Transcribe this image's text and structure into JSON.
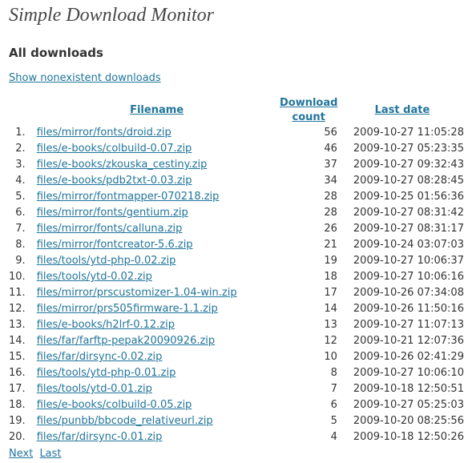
{
  "page": {
    "title": "Simple Download Monitor",
    "subtitle": "All downloads",
    "show_nonexistent_link": "Show nonexistent downloads"
  },
  "table": {
    "columns": {
      "filename": "Filename",
      "download_count_line1": "Download",
      "download_count_line2": "count",
      "last_date": "Last date"
    },
    "rows": [
      {
        "num": "1.",
        "file": "files/mirror/fonts/droid.zip",
        "count": "56",
        "date": "2009-10-27 11:05:28"
      },
      {
        "num": "2.",
        "file": "files/e-books/colbuild-0.07.zip",
        "count": "46",
        "date": "2009-10-27 05:23:35"
      },
      {
        "num": "3.",
        "file": "files/e-books/zkouska_cestiny.zip",
        "count": "37",
        "date": "2009-10-27 09:32:43"
      },
      {
        "num": "4.",
        "file": "files/e-books/pdb2txt-0.03.zip",
        "count": "34",
        "date": "2009-10-27 08:28:45"
      },
      {
        "num": "5.",
        "file": "files/mirror/fontmapper-070218.zip",
        "count": "28",
        "date": "2009-10-25 01:56:36"
      },
      {
        "num": "6.",
        "file": "files/mirror/fonts/gentium.zip",
        "count": "28",
        "date": "2009-10-27 08:31:42"
      },
      {
        "num": "7.",
        "file": "files/mirror/fonts/calluna.zip",
        "count": "26",
        "date": "2009-10-27 08:31:17"
      },
      {
        "num": "8.",
        "file": "files/mirror/fontcreator-5.6.zip",
        "count": "21",
        "date": "2009-10-24 03:07:03"
      },
      {
        "num": "9.",
        "file": "files/tools/ytd-php-0.02.zip",
        "count": "19",
        "date": "2009-10-27 10:06:37"
      },
      {
        "num": "10.",
        "file": "files/tools/ytd-0.02.zip",
        "count": "18",
        "date": "2009-10-27 10:06:16"
      },
      {
        "num": "11.",
        "file": "files/mirror/prscustomizer-1.04-win.zip",
        "count": "17",
        "date": "2009-10-26 07:34:08"
      },
      {
        "num": "12.",
        "file": "files/mirror/prs505firmware-1.1.zip",
        "count": "14",
        "date": "2009-10-26 11:50:16"
      },
      {
        "num": "13.",
        "file": "files/e-books/h2lrf-0.12.zip",
        "count": "13",
        "date": "2009-10-27 11:07:13"
      },
      {
        "num": "14.",
        "file": "files/far/farftp-pepak20090926.zip",
        "count": "12",
        "date": "2009-10-21 12:07:36"
      },
      {
        "num": "15.",
        "file": "files/far/dirsync-0.02.zip",
        "count": "10",
        "date": "2009-10-26 02:41:29"
      },
      {
        "num": "16.",
        "file": "files/tools/ytd-php-0.01.zip",
        "count": "8",
        "date": "2009-10-27 10:06:10"
      },
      {
        "num": "17.",
        "file": "files/tools/ytd-0.01.zip",
        "count": "7",
        "date": "2009-10-18 12:50:51"
      },
      {
        "num": "18.",
        "file": "files/e-books/colbuild-0.05.zip",
        "count": "6",
        "date": "2009-10-27 05:25:03"
      },
      {
        "num": "19.",
        "file": "files/punbb/bbcode_relativeurl.zip",
        "count": "5",
        "date": "2009-10-20 08:25:56"
      },
      {
        "num": "20.",
        "file": "files/far/dirsync-0.01.zip",
        "count": "4",
        "date": "2009-10-18 12:50:26"
      }
    ]
  },
  "pager": {
    "next": "Next",
    "last": "Last"
  },
  "colors": {
    "link": "#21759b",
    "text": "#333333",
    "title": "#464646"
  }
}
